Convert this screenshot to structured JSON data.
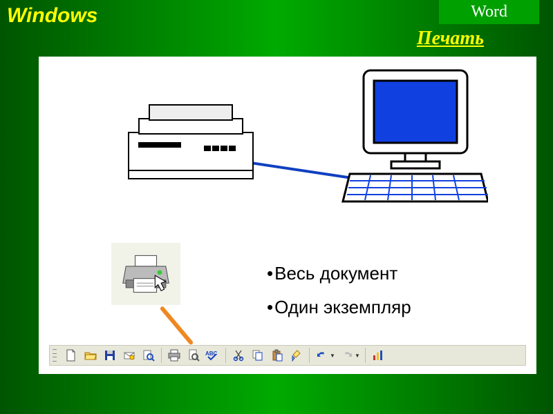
{
  "header": {
    "left_title": "Windows",
    "right_title": "Word"
  },
  "subtitle": "Печать",
  "bullets": [
    "Весь документ",
    "Один экземпляр"
  ],
  "toolbar": {
    "buttons": [
      {
        "name": "new-document-icon"
      },
      {
        "name": "open-folder-icon"
      },
      {
        "name": "save-disk-icon"
      },
      {
        "name": "mail-icon"
      },
      {
        "name": "search-icon"
      },
      {
        "sep": true
      },
      {
        "name": "print-icon"
      },
      {
        "name": "print-preview-icon"
      },
      {
        "name": "spellcheck-icon"
      },
      {
        "sep": true
      },
      {
        "name": "cut-icon"
      },
      {
        "name": "copy-icon"
      },
      {
        "name": "paste-icon"
      },
      {
        "name": "format-painter-icon"
      },
      {
        "sep": true
      },
      {
        "name": "undo-icon",
        "dropdown": true
      },
      {
        "name": "redo-icon",
        "dropdown": true
      },
      {
        "sep": true
      },
      {
        "name": "chart-icon"
      }
    ]
  }
}
